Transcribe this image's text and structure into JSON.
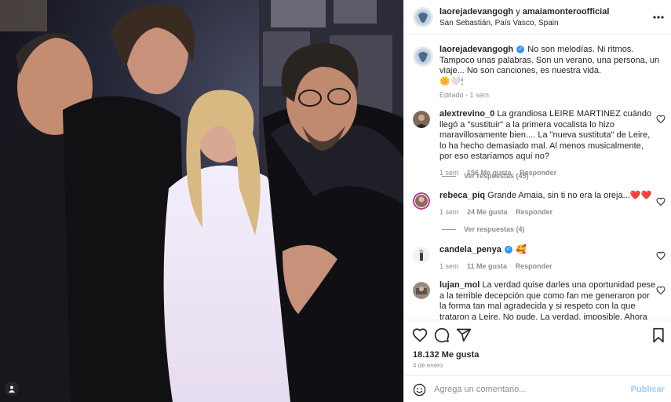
{
  "post": {
    "header": {
      "author": "laorejadevangogh",
      "connector": " y ",
      "coauthor": "amaiamonteroofficial",
      "location": "San Sebastián, País Vasco, Spain"
    },
    "caption": {
      "username": "laorejadevangogh",
      "verified": true,
      "text": "No son melodías. Ni ritmos. Tampoco unas palabras. Son un verano, una persona, un viaje... No son canciones, es nuestra vida.",
      "emojis": "🌼🤍🕯",
      "edited": "Editado",
      "age": "1 sem"
    },
    "comments": [
      {
        "username": "alextrevino_0",
        "text": "La grandiosa LEIRE MARTINEZ cuándo llegó a \"sustituir\" a la primera vocalista lo hizo maravillosamente bien.... La \"nueva sustituta\" de Leire, lo ha hecho demasiado mal. Al menos musicalmente, por eso estaríamos aquí no?",
        "age": "1 sem",
        "likes": "156 Me gusta",
        "reply": "Responder",
        "view_replies": "Ver respuestas (45)"
      },
      {
        "username": "rebeca_piq",
        "text": "Grande Amaia, sin ti no era la oreja...❤️❤️",
        "age": "1 sem",
        "likes": "24 Me gusta",
        "reply": "Responder",
        "view_replies": "Ver respuestas (4)"
      },
      {
        "username": "candela_penya",
        "verified": true,
        "text": "🥰",
        "age": "1 sem",
        "likes": "11 Me gusta",
        "reply": "Responder"
      },
      {
        "username": "lujan_mol",
        "text": "La verdad quise darles una oportunidad pese a la terrible decepción que como fan me generaron por la forma tan mal agradecida y si respeto con la que trataron a Leire. No pude. La verdad, imposible. Ahora cantan cosas sobre Dios"
      }
    ],
    "likes_count": "18.132 Me gusta",
    "date": "4 de enero",
    "add_comment": {
      "placeholder": "Agrega un comentario...",
      "publish": "Publicar"
    }
  },
  "icons": {
    "more": "more-horizontal-icon",
    "like": "heart-icon",
    "comment": "comment-bubble-icon",
    "share": "paper-plane-icon",
    "save": "bookmark-icon",
    "emoji": "smile-icon",
    "tagged": "user-tag-icon"
  },
  "colors": {
    "verified": "#3897f0",
    "publish": "#9ecbf6",
    "muted": "#8e8e8e",
    "text": "#262626"
  }
}
